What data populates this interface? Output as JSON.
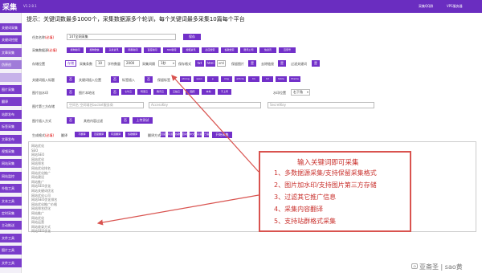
{
  "app": {
    "title": "采集",
    "version": "V1.2.8.1",
    "qq_label": "采集QQ群",
    "vps_label": "VPS服务器"
  },
  "sidebar": {
    "items": [
      {
        "label": "关键词采集",
        "color": "#7a3ccb"
      },
      {
        "label": "关键词挖掘",
        "color": "#7a3ccb"
      },
      {
        "label": "文章采集",
        "color": "#8e58d2"
      },
      {
        "label": "伪原创",
        "color": "#a07cd9"
      },
      {
        "label": "",
        "color": "#c7b2ea"
      },
      {
        "label": "图片采集",
        "color": "#7a3ccb"
      },
      {
        "label": "翻译",
        "color": "#7a3ccb"
      },
      {
        "label": "站群发布",
        "color": "#7a3ccb"
      },
      {
        "label": "标签采集",
        "color": "#7a3ccb"
      },
      {
        "label": "文章发布",
        "color": "#7a3ccb"
      },
      {
        "label": "视频采集",
        "color": "#7a3ccb"
      },
      {
        "label": "网站采集",
        "color": "#7a3ccb"
      },
      {
        "label": "网站监控",
        "color": "#7a3ccb"
      },
      {
        "label": "外链工具",
        "color": "#7a3ccb"
      },
      {
        "label": "文本工具",
        "color": "#7a3ccb"
      },
      {
        "label": "定时采集",
        "color": "#7a3ccb"
      },
      {
        "label": "主动推送",
        "color": "#7a3ccb"
      },
      {
        "label": "文件工具",
        "color": "#7a3ccb"
      },
      {
        "label": "图片工具",
        "color": "#7a3ccb"
      },
      {
        "label": "文件工具",
        "color": "#7a3ccb"
      }
    ]
  },
  "hint": "提示：关键词数最多1000个，采集数据源多个轮训，每个关键词最多采集10篇每个平台",
  "form": {
    "task_name": {
      "label": "任务名称",
      "required": "(必填)",
      "value": "147全网采集",
      "button": "保存"
    },
    "sources": {
      "label": "采集数据源",
      "required": "(必填)",
      "tags": [
        "搜狗新闻",
        "搜狗微信",
        "头条资讯",
        "网易新闻",
        "百度新闻",
        "360新闻",
        "搜狐资讯",
        "必应搜索",
        "谷歌搜索",
        "腾讯公司",
        "快资讯",
        "百家号"
      ]
    },
    "settings": {
      "label": "存储位置",
      "save_label": "存储",
      "count_label": "采集条数",
      "count_value": "10",
      "length_label": "字符数量",
      "length_value": "2000",
      "interval_label": "采集间隔",
      "interval_value": "1秒",
      "format_label": "保存格式",
      "formats": [
        "txt",
        "html",
        "xml"
      ],
      "pic_label": "保留图片",
      "pic_value": "是",
      "dedup_label": "去除链接",
      "dedup_value": "是",
      "filter_label": "过滤关键词",
      "filter_value": "是"
    },
    "insert": {
      "label": "关键词插入标题",
      "toggle": "否",
      "count_label": "关键词插入位置",
      "count_value": "否",
      "tag_label": "标签插入",
      "tag_value": "否",
      "tags_label": "保留标签",
      "tags": [
        "strong",
        "span",
        "p",
        "img",
        "article",
        "h1",
        "h2",
        "table",
        "iframe"
      ]
    },
    "watermark": {
      "label": "图片加水印",
      "toggle": "否",
      "pic_label": "图片本地化",
      "pic_toggle": "否",
      "options": [
        "七牛云",
        "阿里云",
        "腾讯云",
        "又拍云",
        "图床",
        "本地",
        "不上传"
      ],
      "position_label": "水印位置",
      "position_value": "右下角"
    },
    "storage": {
      "label": "图片第三方存储",
      "bucket_placeholder": "空间名 空间域名bucket服务商",
      "access_placeholder": "AccessKey",
      "secret_placeholder": "SecretKey"
    },
    "filter": {
      "label": "图片插入方式",
      "toggle": "否",
      "mode_label": "其他内容过滤",
      "mode_value": "否",
      "test_button": "上传测试"
    },
    "publish": {
      "label": "生成格式",
      "required": "(必填)",
      "translate_label": "翻译",
      "translate_opts": [
        "不翻译",
        "百度翻译",
        "有道翻译",
        "谷歌翻译"
      ],
      "engine_label": "翻译方式",
      "engine_opts": [
        "百度翻译",
        "有道翻译",
        "谷歌翻译",
        "自动",
        "中文",
        "英语",
        "日语"
      ],
      "start_button": "开始采集",
      "action_button": "确定"
    }
  },
  "keywords": [
    "网站优化",
    "SEO",
    "网站SEO",
    "网站优化",
    "网站排名",
    "网站优化排名",
    "网站优化推广",
    "网站建设",
    "网站推广",
    "网站SEO优化",
    "网站关键词优化",
    "网站优化公司",
    "网站SEO优化排名",
    "网站优化推广价格",
    "网站排名优化",
    "网站推广",
    "网站优化",
    "网站运营",
    "网站收录方式",
    "网站SEO优化"
  ],
  "callout": {
    "title": "输入关键词即可采集",
    "items": [
      "1、多数据源采集/支持保留采集格式",
      "2、图片加水印/支持图片第三方存储",
      "3、过滤其它推广信息",
      "4、采集内容翻译",
      "5、支持站群格式采集"
    ],
    "color": "#c9302c"
  },
  "watermark_text": "亚斋圣 | sao黄",
  "colors": {
    "brand": "#6a2dc0",
    "accent": "#7230c9",
    "callout": "#d9534f"
  }
}
